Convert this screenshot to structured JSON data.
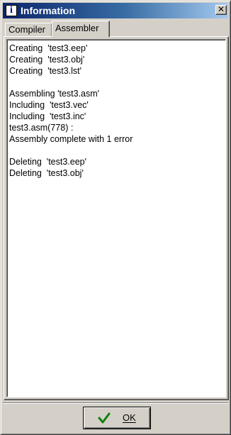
{
  "window": {
    "title": "Information",
    "title_icon": "i",
    "close_glyph": "✕"
  },
  "tabs": [
    {
      "label": "Compiler",
      "active": false
    },
    {
      "label": "Assembler",
      "active": true
    }
  ],
  "log": {
    "lines": [
      "Creating  'test3.eep'",
      "Creating  'test3.obj'",
      "Creating  'test3.lst'",
      "",
      "Assembling 'test3.asm'",
      "Including  'test3.vec'",
      "Including  'test3.inc'",
      "test3.asm(778) :",
      "Assembly complete with 1 error",
      "",
      "Deleting  'test3.eep'",
      "Deleting  'test3.obj'"
    ]
  },
  "ok_button": {
    "label": "OK",
    "icon": "checkmark-icon",
    "icon_color": "#108010"
  }
}
